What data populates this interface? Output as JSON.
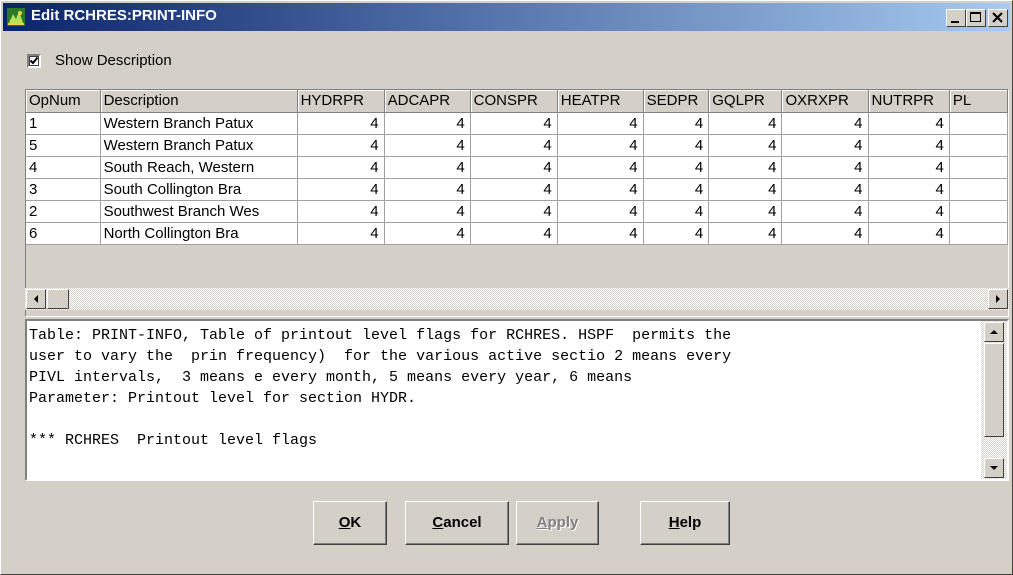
{
  "window": {
    "title": "Edit RCHRES:PRINT-INFO",
    "icon": "app-icon",
    "controls": [
      "minimize-icon",
      "maximize-icon",
      "close-icon"
    ]
  },
  "options": {
    "show_description_label": "Show Description",
    "show_description_checked": true
  },
  "table": {
    "columns": [
      "OpNum",
      "Description",
      "HYDRPR",
      "ADCAPR",
      "CONSPR",
      "HEATPR",
      "SEDPR",
      "GQLPR",
      "OXRXPR",
      "NUTRPR",
      "PL"
    ],
    "rows": [
      [
        "1",
        "Western Branch Patux",
        "4",
        "4",
        "4",
        "4",
        "4",
        "4",
        "4",
        "4",
        ""
      ],
      [
        "5",
        "Western Branch Patux",
        "4",
        "4",
        "4",
        "4",
        "4",
        "4",
        "4",
        "4",
        ""
      ],
      [
        "4",
        "South Reach, Western",
        "4",
        "4",
        "4",
        "4",
        "4",
        "4",
        "4",
        "4",
        ""
      ],
      [
        "3",
        "South Collington Bra",
        "4",
        "4",
        "4",
        "4",
        "4",
        "4",
        "4",
        "4",
        ""
      ],
      [
        "2",
        "Southwest Branch Wes",
        "4",
        "4",
        "4",
        "4",
        "4",
        "4",
        "4",
        "4",
        ""
      ],
      [
        "6",
        "North Collington Bra",
        "4",
        "4",
        "4",
        "4",
        "4",
        "4",
        "4",
        "4",
        ""
      ]
    ]
  },
  "description": {
    "text": "Table: PRINT-INFO, Table of printout level flags for RCHRES. HSPF  permits the\nuser to vary the  prin frequency)  for the various active sectio 2 means every\nPIVL intervals,  3 means e every month, 5 means every year, 6 means\nParameter: Printout level for section HYDR.\n\n*** RCHRES  Printout level flags"
  },
  "buttons": {
    "ok": {
      "mnemonic": "O",
      "rest": "K"
    },
    "cancel": {
      "mnemonic": "C",
      "rest": "ancel"
    },
    "apply": {
      "mnemonic": "A",
      "rest": "pply",
      "disabled": true
    },
    "help": {
      "mnemonic": "H",
      "rest": "elp"
    }
  },
  "colors": {
    "titlebar_start": "#0a246a",
    "titlebar_end": "#a6caf0",
    "face": "#d4d0c8"
  }
}
